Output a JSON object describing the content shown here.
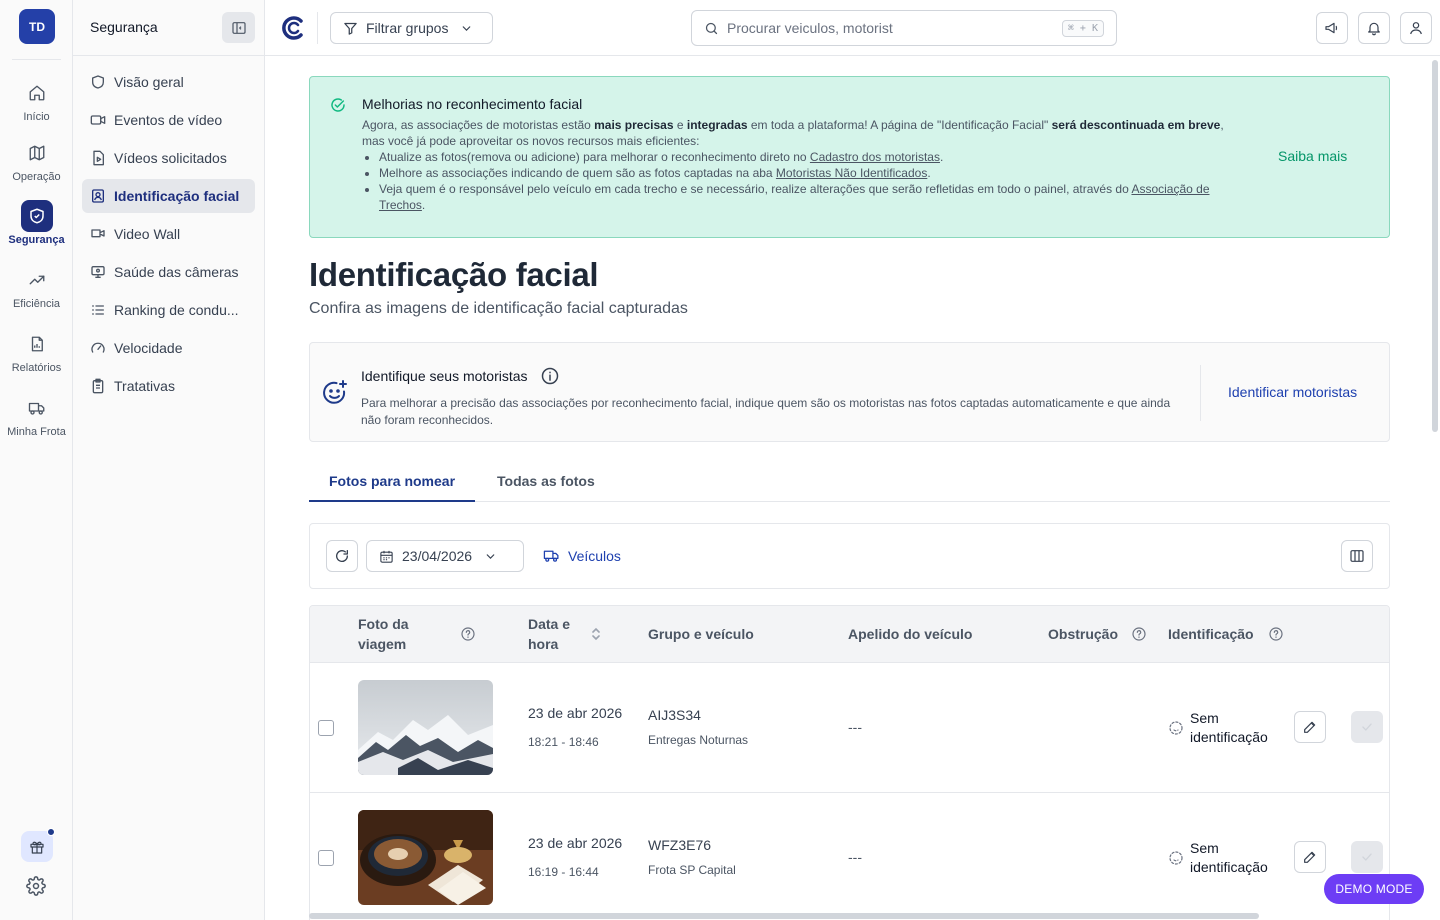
{
  "rail": {
    "avatar": "TD",
    "items": [
      {
        "label": "Início",
        "icon": "home-icon"
      },
      {
        "label": "Operação",
        "icon": "map-icon"
      },
      {
        "label": "Segurança",
        "icon": "shield-icon",
        "active": true
      },
      {
        "label": "Eficiência",
        "icon": "trending-up-icon"
      },
      {
        "label": "Relatórios",
        "icon": "report-icon"
      },
      {
        "label": "Minha Frota",
        "icon": "truck-icon"
      }
    ]
  },
  "sidebar": {
    "title": "Segurança",
    "items": [
      {
        "label": "Visão geral",
        "icon": "shield-icon"
      },
      {
        "label": "Eventos de vídeo",
        "icon": "video-icon"
      },
      {
        "label": "Vídeos solicitados",
        "icon": "file-video-icon"
      },
      {
        "label": "Identificação facial",
        "icon": "face-id-icon",
        "active": true
      },
      {
        "label": "Video Wall",
        "icon": "video-wall-icon"
      },
      {
        "label": "Saúde das câmeras",
        "icon": "monitor-icon"
      },
      {
        "label": "Ranking de condu...",
        "icon": "list-icon"
      },
      {
        "label": "Velocidade",
        "icon": "gauge-icon"
      },
      {
        "label": "Tratativas",
        "icon": "clipboard-icon"
      }
    ]
  },
  "topbar": {
    "filter_label": "Filtrar grupos",
    "search_placeholder": "Procurar veiculos, motorist",
    "search_shortcut": "⌘ + K"
  },
  "banner": {
    "title": "Melhorias no reconhecimento facial",
    "p1_a": "Agora, as associações de motoristas estão ",
    "p1_b": "mais precisas",
    "p1_c": " e ",
    "p1_d": "integradas",
    "p1_e": " em toda a plataforma! A página de \"Identificação Facial\" ",
    "p1_f": "será descontinuada em breve",
    "p1_g": ",",
    "p2": "mas você já pode aproveitar os novos recursos mais eficientes:",
    "b1_text": "Atualize as fotos(remova ou adicione) para melhorar o reconhecimento direto no ",
    "b1_link": "Cadastro dos motoristas",
    "b2_text": "Melhore as associações indicando de quem são as fotos captadas na aba ",
    "b2_link": "Motoristas Não Identificados",
    "b3_text": "Veja quem é o responsável pelo veículo em cada trecho e se necessário, realize alterações que serão refletidas em todo o painel, através do ",
    "b3_link": "Associação de Trechos",
    "period": ".",
    "link": "Saiba mais"
  },
  "page": {
    "title": "Identificação facial",
    "subtitle": "Confira as imagens de identificação facial capturadas"
  },
  "identify_card": {
    "title": "Identifique seus motoristas",
    "description": "Para melhorar a precisão das associações por reconhecimento facial, indique quem são os motoristas nas fotos captadas automaticamente e que ainda não foram reconhecidos.",
    "action": "Identificar motoristas"
  },
  "tabs": [
    {
      "label": "Fotos para nomear",
      "active": true
    },
    {
      "label": "Todas as fotos"
    }
  ],
  "toolbar": {
    "date": "23/04/2026",
    "vehicles_label": "Veículos"
  },
  "table": {
    "headers": {
      "photo": "Foto da viagem",
      "datetime": "Data e hora",
      "group_vehicle": "Grupo e veículo",
      "nickname": "Apelido do veículo",
      "obstruction": "Obstrução",
      "identification": "Identificação"
    },
    "rows": [
      {
        "photo": "snowy-mountains-photo",
        "date": "23 de abr 2026",
        "time": "18:21 - 18:46",
        "plate": "AIJ3S34",
        "group": "Entregas Noturnas",
        "nickname": "---",
        "identification": "Sem identificação"
      },
      {
        "photo": "coffee-cup-photo",
        "date": "23 de abr 2026",
        "time": "16:19 - 16:44",
        "plate": "WFZ3E76",
        "group": "Frota SP Capital",
        "nickname": "---",
        "identification": "Sem identificação"
      }
    ]
  },
  "demo_badge": "DEMO MODE",
  "colors": {
    "brand_navy": "#1e2f7e",
    "banner_bg": "#d5f4ea",
    "banner_accent": "#059669",
    "link_blue": "#1e40af",
    "demo_purple": "#6d3df5"
  }
}
